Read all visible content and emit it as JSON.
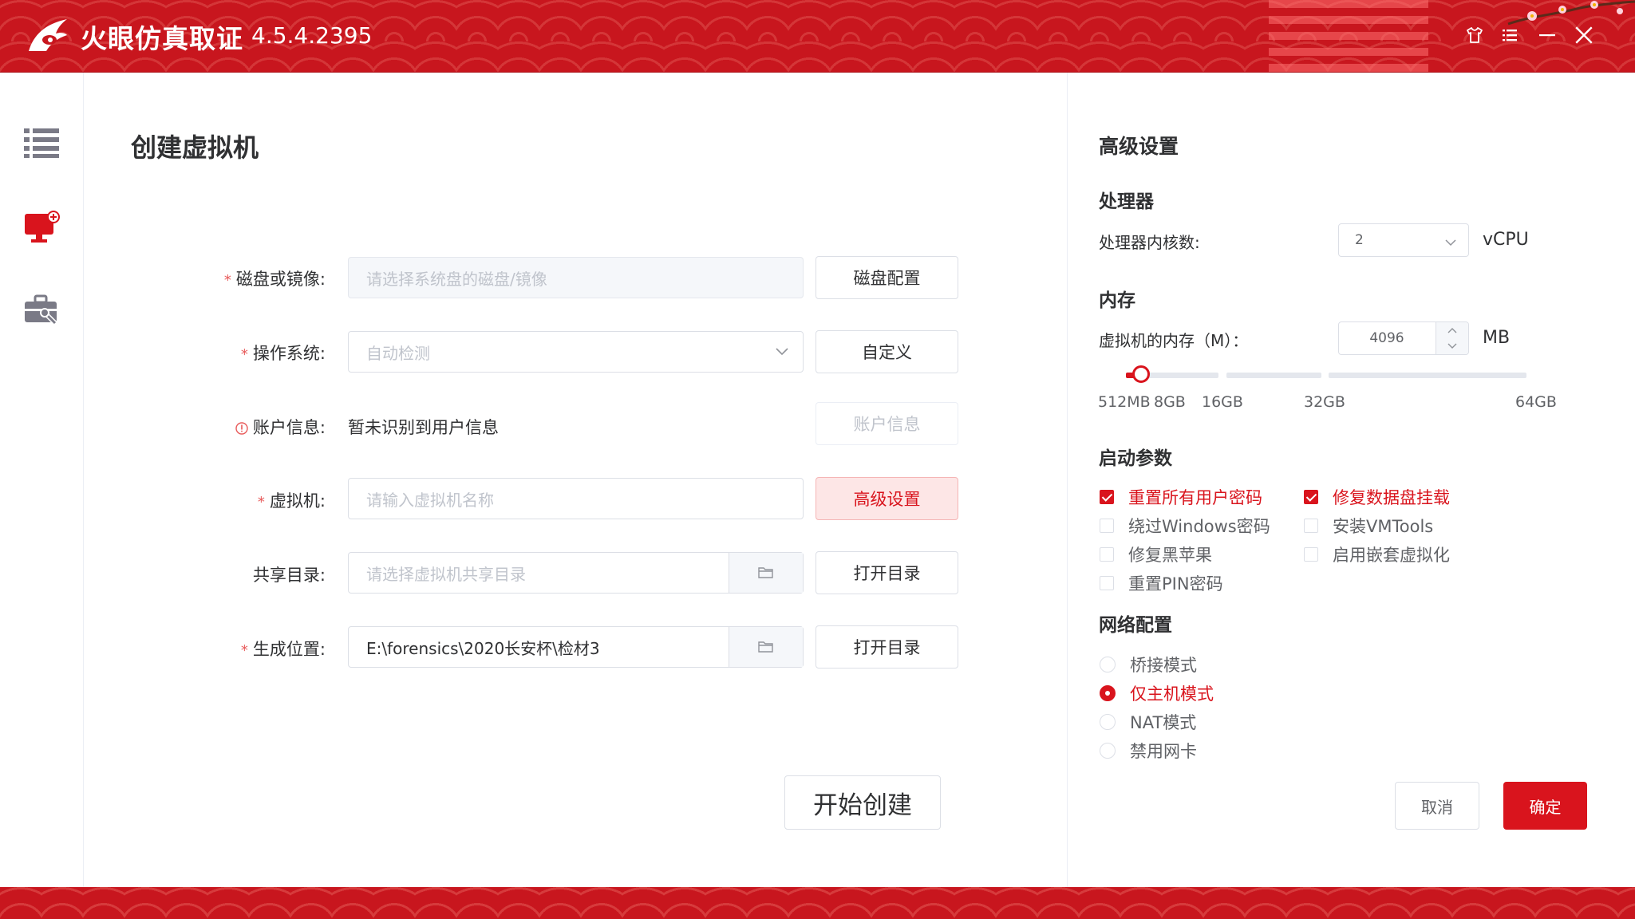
{
  "app": {
    "name": "火眼仿真取证",
    "version": "4.5.4.2395",
    "accent_color": "#d9141d",
    "titlebar_icons": [
      "shirt-icon",
      "menu-icon",
      "minimize-icon",
      "close-icon"
    ]
  },
  "nav": {
    "items": [
      "list-icon",
      "create-vm-icon",
      "toolbox-icon"
    ],
    "active": "create-vm-icon"
  },
  "form": {
    "title": "创建虚拟机",
    "disk": {
      "label": "磁盘或镜像:",
      "placeholder": "请选择系统盘的磁盘/镜像",
      "button": "磁盘配置"
    },
    "os": {
      "label": "操作系统:",
      "placeholder": "自动检测",
      "button": "自定义"
    },
    "account": {
      "label": "账户信息:",
      "value": "暂未识别到用户信息",
      "button": "账户信息"
    },
    "vm": {
      "label": "虚拟机:",
      "placeholder": "请输入虚拟机名称",
      "button": "高级设置"
    },
    "share": {
      "label": "共享目录:",
      "placeholder": "请选择虚拟机共享目录",
      "button": "打开目录"
    },
    "output": {
      "label": "生成位置:",
      "value": "E:\\forensics\\2020长安杯\\检材3",
      "button": "打开目录"
    },
    "start_button": "开始创建"
  },
  "advanced": {
    "title": "高级设置",
    "cpu": {
      "section": "处理器",
      "label": "处理器内核数:",
      "value": "2",
      "unit": "vCPU"
    },
    "memory": {
      "section": "内存",
      "label": "虚拟机的内存（M）：",
      "value": "4096",
      "unit": "MB",
      "slider_ticks": [
        "512MB",
        "8GB",
        "16GB",
        "32GB",
        "64GB"
      ]
    },
    "boot": {
      "section": "启动参数",
      "options": [
        {
          "label": "重置所有用户密码",
          "checked": true
        },
        {
          "label": "修复数据盘挂载",
          "checked": true
        },
        {
          "label": "绕过Windows密码",
          "checked": false
        },
        {
          "label": "安装VMTools",
          "checked": false
        },
        {
          "label": "修复黑苹果",
          "checked": false
        },
        {
          "label": "启用嵌套虚拟化",
          "checked": false
        },
        {
          "label": "重置PIN密码",
          "checked": false
        }
      ]
    },
    "network": {
      "section": "网络配置",
      "options": [
        {
          "label": "桥接模式",
          "selected": false
        },
        {
          "label": "仅主机模式",
          "selected": true
        },
        {
          "label": "NAT模式",
          "selected": false
        },
        {
          "label": "禁用网卡",
          "selected": false
        }
      ]
    },
    "cancel": "取消",
    "confirm": "确定"
  }
}
